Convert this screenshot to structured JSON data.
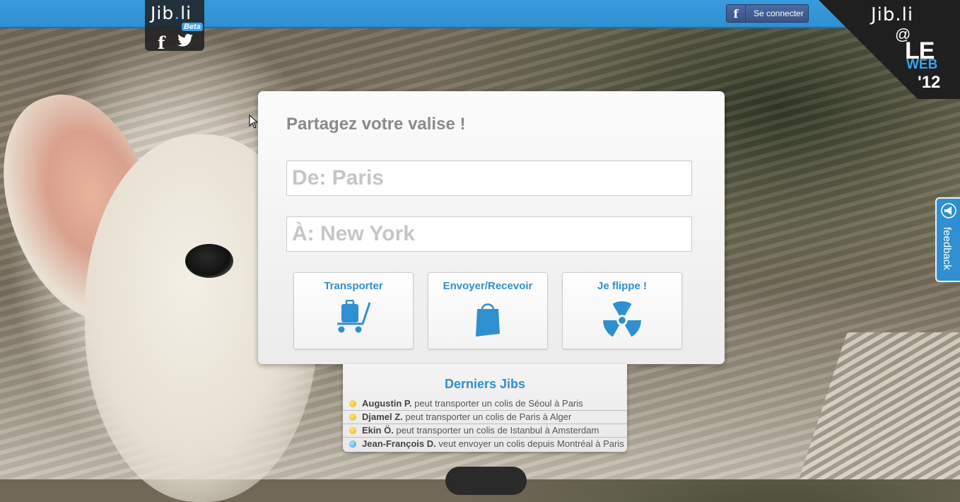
{
  "brand": {
    "logo_text": "Jib.li",
    "beta_label": "Beta"
  },
  "header": {
    "connect_label": "Se connecter",
    "event_brand": "Jib.li",
    "event_at": "@",
    "event_le": "LE",
    "event_web": "WEB",
    "event_year": "'12"
  },
  "search": {
    "title": "Partagez votre valise !",
    "from_placeholder": "De: Paris",
    "to_placeholder": "À: New York"
  },
  "options": [
    {
      "label": "Transporter",
      "icon": "luggage-cart-icon"
    },
    {
      "label": "Envoyer/Recevoir",
      "icon": "shopping-bag-icon"
    },
    {
      "label": "Je flippe !",
      "icon": "radiation-icon"
    }
  ],
  "latest": {
    "title": "Derniers Jibs",
    "items": [
      {
        "name": "Augustin P.",
        "text": "peut transporter un colis de Séoul à Paris",
        "dot": "yellow"
      },
      {
        "name": "Djamel Z.",
        "text": "peut transporter un colis de Paris à Alger",
        "dot": "yellow"
      },
      {
        "name": "Ekin Ö.",
        "text": "peut transporter un colis de Istanbul à Amsterdam",
        "dot": "yellow"
      },
      {
        "name": "Jean-François D.",
        "text": "veut envoyer un colis depuis Montréal à Paris",
        "dot": "blue"
      }
    ]
  },
  "feedback": {
    "label": "feedback"
  },
  "colors": {
    "accent": "#2f8fd0",
    "topbar": "#3a9bdc",
    "facebook": "#3b5998"
  }
}
